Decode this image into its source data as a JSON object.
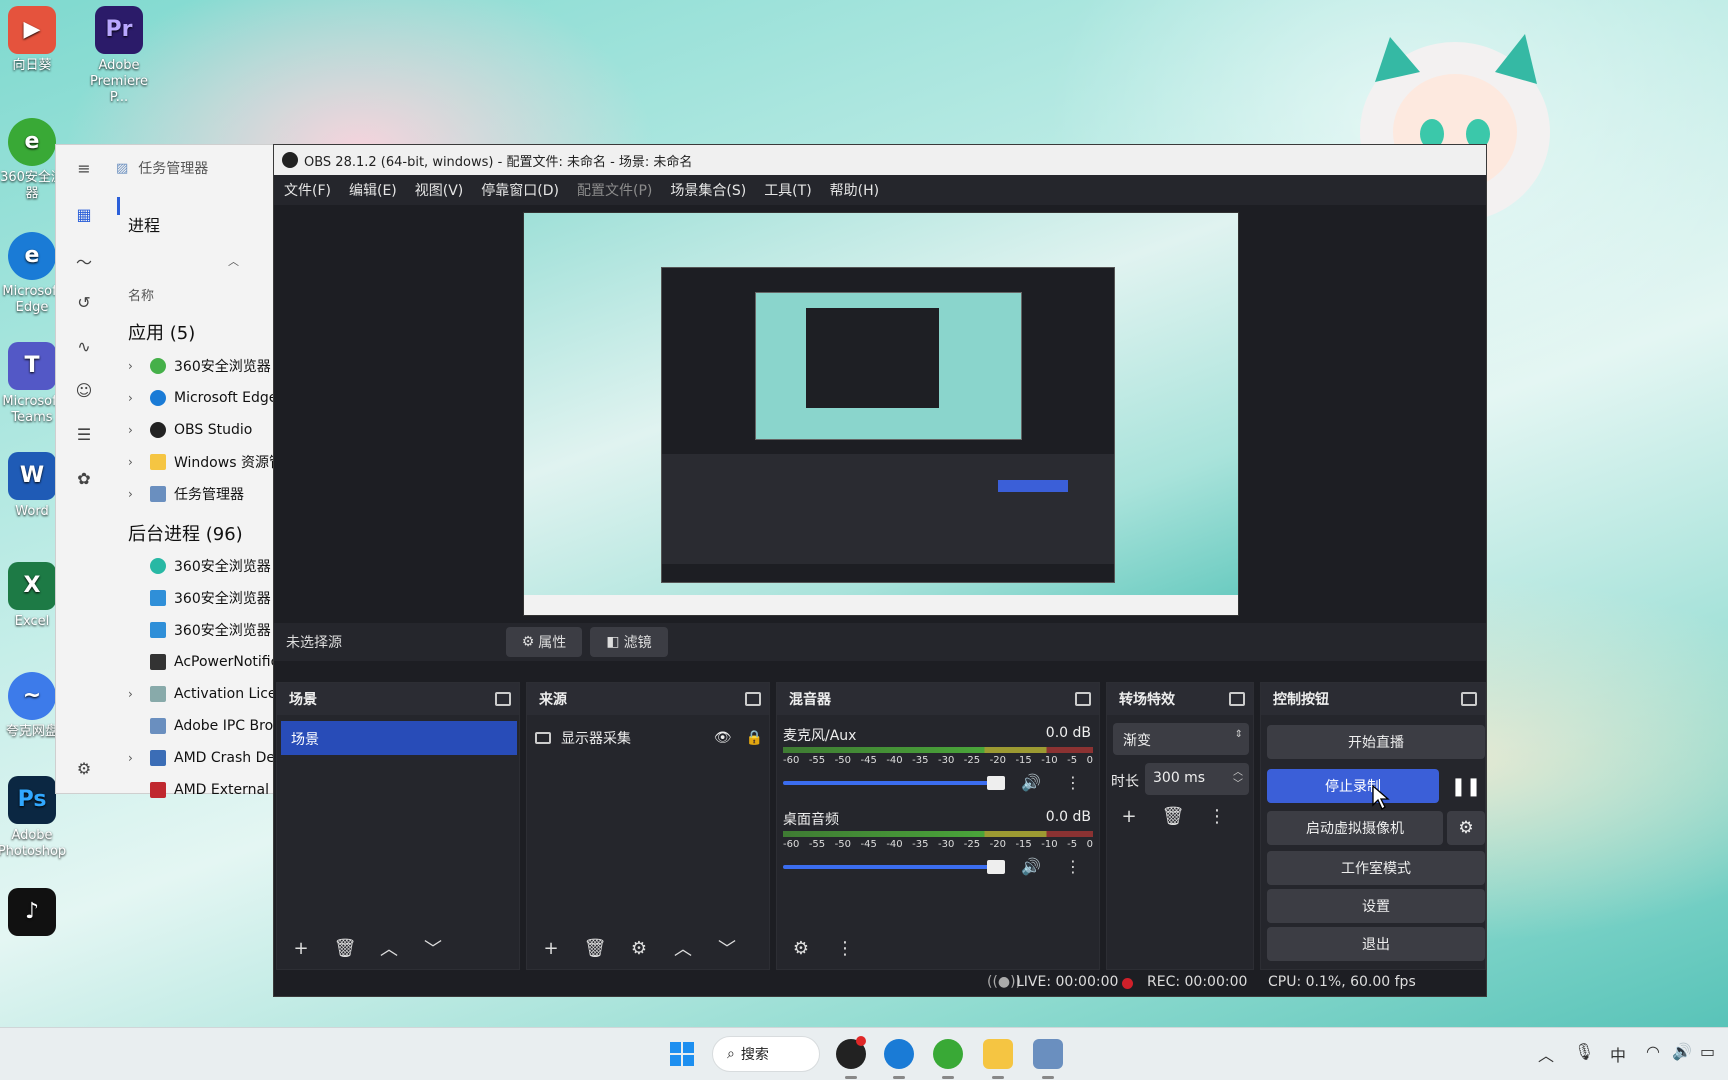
{
  "desktop": {
    "icons": [
      {
        "label": "向日葵",
        "letter": "▶",
        "color": "#e5533d"
      },
      {
        "label": "Adobe\nPremiere P...",
        "letter": "Pr",
        "color": "#2b1b69"
      },
      {
        "label": "360安全浏\n器",
        "letter": "e",
        "color": "#39a936"
      },
      {
        "label": "Microsoft\nEdge",
        "letter": "e",
        "color": "#1a7bd6"
      },
      {
        "label": "Microsoft\nTeams",
        "letter": "T",
        "color": "#5358c6"
      },
      {
        "label": "Word",
        "letter": "W",
        "color": "#1f5bb6"
      },
      {
        "label": "Excel",
        "letter": "X",
        "color": "#1d7a45"
      },
      {
        "label": "夸克网盘",
        "letter": "~",
        "color": "#3d7bea"
      },
      {
        "label": "Adobe\nPhotoshop",
        "letter": "Ps",
        "color": "#0b2742"
      },
      {
        "label": "",
        "letter": "♪",
        "color": "#111"
      }
    ]
  },
  "task_manager": {
    "title": "任务管理器",
    "section": "进程",
    "column_name": "名称",
    "apps_header": "应用 (5)",
    "apps": [
      "360安全浏览器",
      "Microsoft Edge",
      "OBS Studio",
      "Windows 资源管",
      "任务管理器"
    ],
    "bg_header": "后台进程 (96)",
    "bg": [
      "360安全浏览器",
      "360安全浏览器",
      "360安全浏览器",
      "AcPowerNotific",
      "Activation Licer",
      "Adobe IPC Brok",
      "AMD Crash Def",
      "AMD External E"
    ]
  },
  "obs": {
    "title": "OBS 28.1.2 (64-bit, windows) - 配置文件: 未命名 - 场景: 未命名",
    "menu": [
      "文件(F)",
      "编辑(E)",
      "视图(V)",
      "停靠窗口(D)",
      "配置文件(P)",
      "场景集合(S)",
      "工具(T)",
      "帮助(H)"
    ],
    "no_source": "未选择源",
    "properties": "属性",
    "filters": "滤镜",
    "scenes": {
      "title": "场景",
      "items": [
        "场景"
      ]
    },
    "sources": {
      "title": "来源",
      "items": [
        "显示器采集"
      ]
    },
    "mixer": {
      "title": "混音器",
      "channels": [
        {
          "name": "麦克风/Aux",
          "db": "0.0 dB"
        },
        {
          "name": "桌面音频",
          "db": "0.0 dB"
        }
      ],
      "ticks": [
        "-60",
        "-55",
        "-50",
        "-45",
        "-40",
        "-35",
        "-30",
        "-25",
        "-20",
        "-15",
        "-10",
        "-5",
        "0"
      ]
    },
    "transitions": {
      "title": "转场特效",
      "type": "渐变",
      "duration_label": "时长",
      "duration": "300 ms"
    },
    "controls": {
      "title": "控制按钮",
      "start_stream": "开始直播",
      "stop_record": "停止录制",
      "virtual_cam": "启动虚拟摄像机",
      "studio_mode": "工作室模式",
      "settings": "设置",
      "exit": "退出"
    },
    "status": {
      "live": "LIVE: 00:00:00",
      "rec": "REC: 00:00:00",
      "cpu": "CPU: 0.1%, 60.00 fps"
    }
  },
  "taskbar": {
    "search": "搜索",
    "ime": "中"
  },
  "colors": {
    "accent": "#3b5fd8",
    "obs_bg": "#1d1e23",
    "dock_bg": "#25262c"
  }
}
